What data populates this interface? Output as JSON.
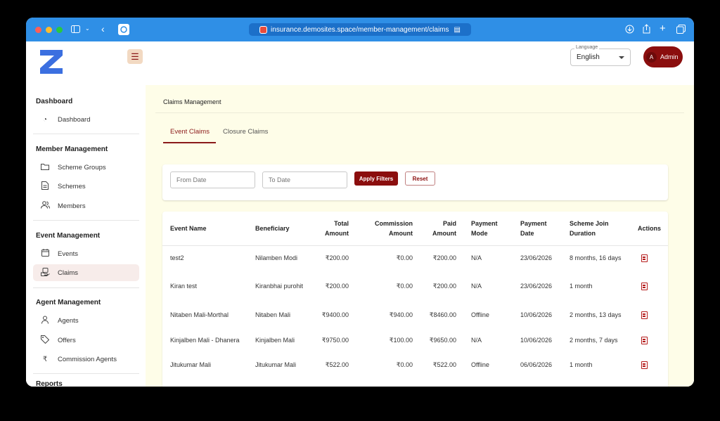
{
  "browser": {
    "url": "insurance.demosites.space/member-management/claims"
  },
  "header": {
    "language_label": "Language",
    "language_value": "English",
    "admin_initial": "A",
    "admin_label": "Admin"
  },
  "sidebar": {
    "sections": [
      {
        "title": "Dashboard",
        "items": [
          {
            "label": "Dashboard",
            "icon": "gauge-icon"
          }
        ]
      },
      {
        "title": "Member Management",
        "items": [
          {
            "label": "Scheme Groups",
            "icon": "folder-icon"
          },
          {
            "label": "Schemes",
            "icon": "document-icon"
          },
          {
            "label": "Members",
            "icon": "users-icon"
          }
        ]
      },
      {
        "title": "Event Management",
        "items": [
          {
            "label": "Events",
            "icon": "calendar-icon"
          },
          {
            "label": "Claims",
            "icon": "claims-icon",
            "active": true
          }
        ]
      },
      {
        "title": "Agent Management",
        "items": [
          {
            "label": "Agents",
            "icon": "user-icon"
          },
          {
            "label": "Offers",
            "icon": "tag-icon"
          },
          {
            "label": "Commission Agents",
            "icon": "rupee-icon"
          }
        ]
      },
      {
        "title": "Reports",
        "items": []
      }
    ]
  },
  "main": {
    "breadcrumb": "Claims Management",
    "tabs": [
      {
        "label": "Event Claims",
        "active": true
      },
      {
        "label": "Closure Claims",
        "active": false
      }
    ],
    "filters": {
      "from_placeholder": "From Date",
      "to_placeholder": "To Date",
      "apply_label": "Apply Filters",
      "reset_label": "Reset"
    },
    "table": {
      "headers": {
        "event_name": "Event Name",
        "beneficiary": "Beneficiary",
        "total_amount": "Total Amount",
        "commission_amount": "Commission Amount",
        "paid_amount": "Paid Amount",
        "payment_mode": "Payment Mode",
        "payment_date": "Payment Date",
        "scheme_join_duration": "Scheme Join Duration",
        "actions": "Actions"
      },
      "rows": [
        {
          "event_name": "test2",
          "beneficiary": "Nilamben Modi",
          "total_amount": "₹200.00",
          "commission_amount": "₹0.00",
          "paid_amount": "₹200.00",
          "payment_mode": "N/A",
          "payment_date": "23/06/2026",
          "duration": "8 months, 16 days"
        },
        {
          "event_name": "Kiran test",
          "beneficiary": "Kiranbhai purohit",
          "total_amount": "₹200.00",
          "commission_amount": "₹0.00",
          "paid_amount": "₹200.00",
          "payment_mode": "N/A",
          "payment_date": "23/06/2026",
          "duration": "1 month"
        },
        {
          "event_name": "Nitaben Mali-Morthal",
          "beneficiary": "Nitaben Mali",
          "total_amount": "₹9400.00",
          "commission_amount": "₹940.00",
          "paid_amount": "₹8460.00",
          "payment_mode": "Offline",
          "payment_date": "10/06/2026",
          "duration": "2 months, 13 days"
        },
        {
          "event_name": "Kinjalben Mali - Dhanera",
          "beneficiary": "Kinjalben Mali",
          "total_amount": "₹9750.00",
          "commission_amount": "₹100.00",
          "paid_amount": "₹9650.00",
          "payment_mode": "N/A",
          "payment_date": "10/06/2026",
          "duration": "2 months, 7 days"
        },
        {
          "event_name": "Jitukumar Mali",
          "beneficiary": "Jitukumar Mali",
          "total_amount": "₹522.00",
          "commission_amount": "₹0.00",
          "paid_amount": "₹522.00",
          "payment_mode": "Offline",
          "payment_date": "06/06/2026",
          "duration": "1 month"
        }
      ]
    }
  },
  "colors": {
    "titlebar": "#2f8fe6",
    "accent": "#8b0e0e",
    "main_bg": "#fefde8",
    "logo": "#3b6fe0"
  }
}
